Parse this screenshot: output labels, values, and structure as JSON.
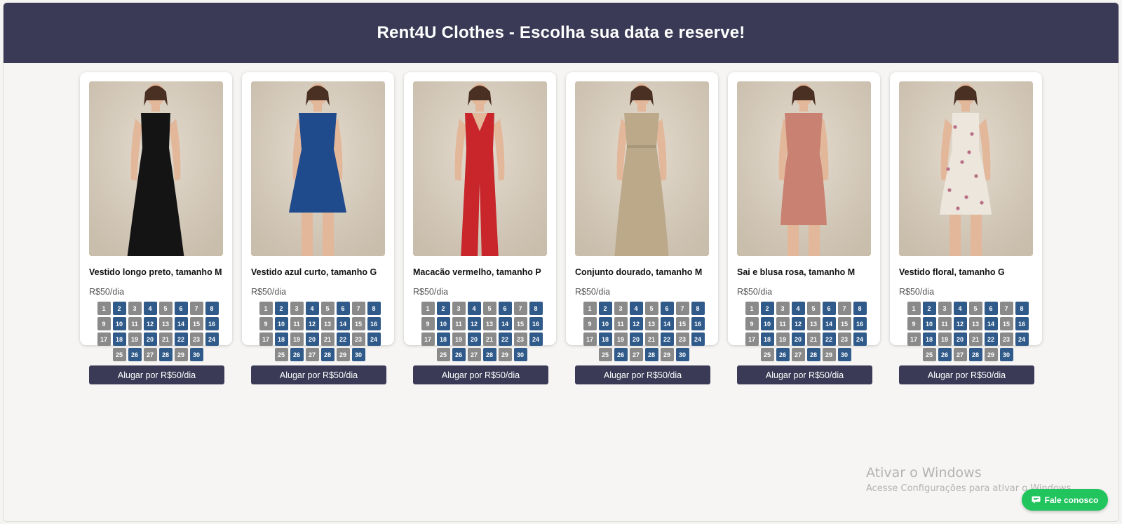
{
  "header": {
    "title": "Rent4U Clothes - Escolha sua data e reserve!"
  },
  "colors": {
    "header_bg": "#3a3a56",
    "day_available": "#2f5a8a",
    "day_unavailable": "#8a8a8a",
    "chat_button": "#21c45d"
  },
  "calendar": {
    "days": [
      "1",
      "2",
      "3",
      "4",
      "5",
      "6",
      "7",
      "8",
      "9",
      "10",
      "11",
      "12",
      "13",
      "14",
      "15",
      "16",
      "17",
      "18",
      "19",
      "20",
      "21",
      "22",
      "23",
      "24",
      "25",
      "26",
      "27",
      "28",
      "29",
      "30"
    ],
    "available_days": [
      2,
      4,
      6,
      8,
      10,
      12,
      14,
      16,
      18,
      20,
      22,
      24,
      26,
      28,
      30
    ]
  },
  "products": [
    {
      "name": "Vestido longo preto, tamanho M",
      "price": "R$50/dia",
      "button": "Alugar por R$50/dia",
      "garment": "long black dress",
      "garment_color": "#141414"
    },
    {
      "name": "Vestido azul curto, tamanho G",
      "price": "R$50/dia",
      "button": "Alugar por R$50/dia",
      "garment": "short blue dress",
      "garment_color": "#1f4a8c"
    },
    {
      "name": "Macacão vermelho, tamanho P",
      "price": "R$50/dia",
      "button": "Alugar por R$50/dia",
      "garment": "red jumpsuit",
      "garment_color": "#c8262b"
    },
    {
      "name": "Conjunto dourado, tamanho M",
      "price": "R$50/dia",
      "button": "Alugar por R$50/dia",
      "garment": "gold set",
      "garment_color": "#bba98a"
    },
    {
      "name": "Sai e blusa rosa, tamanho M",
      "price": "R$50/dia",
      "button": "Alugar por R$50/dia",
      "garment": "pink skirt and blouse",
      "garment_color": "#c98272"
    },
    {
      "name": "Vestido floral, tamanho G",
      "price": "R$50/dia",
      "button": "Alugar por R$50/dia",
      "garment": "floral dress",
      "garment_color": "#ece6dc"
    }
  ],
  "watermark": {
    "title": "Ativar o Windows",
    "subtitle": "Acesse Configurações para ativar o Windows."
  },
  "chat": {
    "label": "Fale conosco",
    "icon": "chat-icon"
  }
}
